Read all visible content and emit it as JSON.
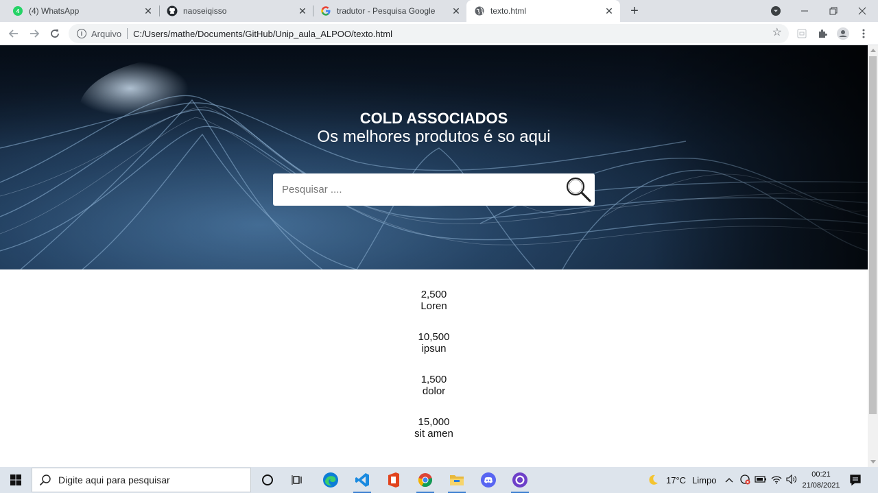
{
  "browser": {
    "tabs": [
      {
        "title": "(4) WhatsApp",
        "icon": "whatsapp-icon",
        "active": false
      },
      {
        "title": "naoseiqisso",
        "icon": "github-icon",
        "active": false
      },
      {
        "title": "tradutor - Pesquisa Google",
        "icon": "google-icon",
        "active": false
      },
      {
        "title": "texto.html",
        "icon": "globe-icon",
        "active": true
      }
    ],
    "new_tab": "+",
    "address": {
      "scheme_label": "Arquivo",
      "url": "C:/Users/mathe/Documents/GitHub/Unip_aula_ALPOO/texto.html"
    }
  },
  "page": {
    "title": "COLD ASSOCIADOS",
    "subtitle": "Os melhores produtos é so aqui",
    "search_placeholder": "Pesquisar ....",
    "stats": [
      {
        "value": "2,500",
        "label": "Loren"
      },
      {
        "value": "10,500",
        "label": "ipsun"
      },
      {
        "value": "1,500",
        "label": "dolor"
      },
      {
        "value": "15,000",
        "label": "sit amen"
      }
    ]
  },
  "taskbar": {
    "search_placeholder": "Digite aqui para pesquisar",
    "weather": {
      "temp": "17°C",
      "condition": "Limpo"
    },
    "time": "00:21",
    "date": "21/08/2021",
    "apps": [
      "cortana",
      "task-view",
      "edge",
      "vscode",
      "office",
      "chrome",
      "file-explorer",
      "discord",
      "github-desktop"
    ]
  },
  "colors": {
    "accent": "#1a73e8",
    "hero_dark": "#0a1522",
    "hero_light": "#4f7fae"
  }
}
